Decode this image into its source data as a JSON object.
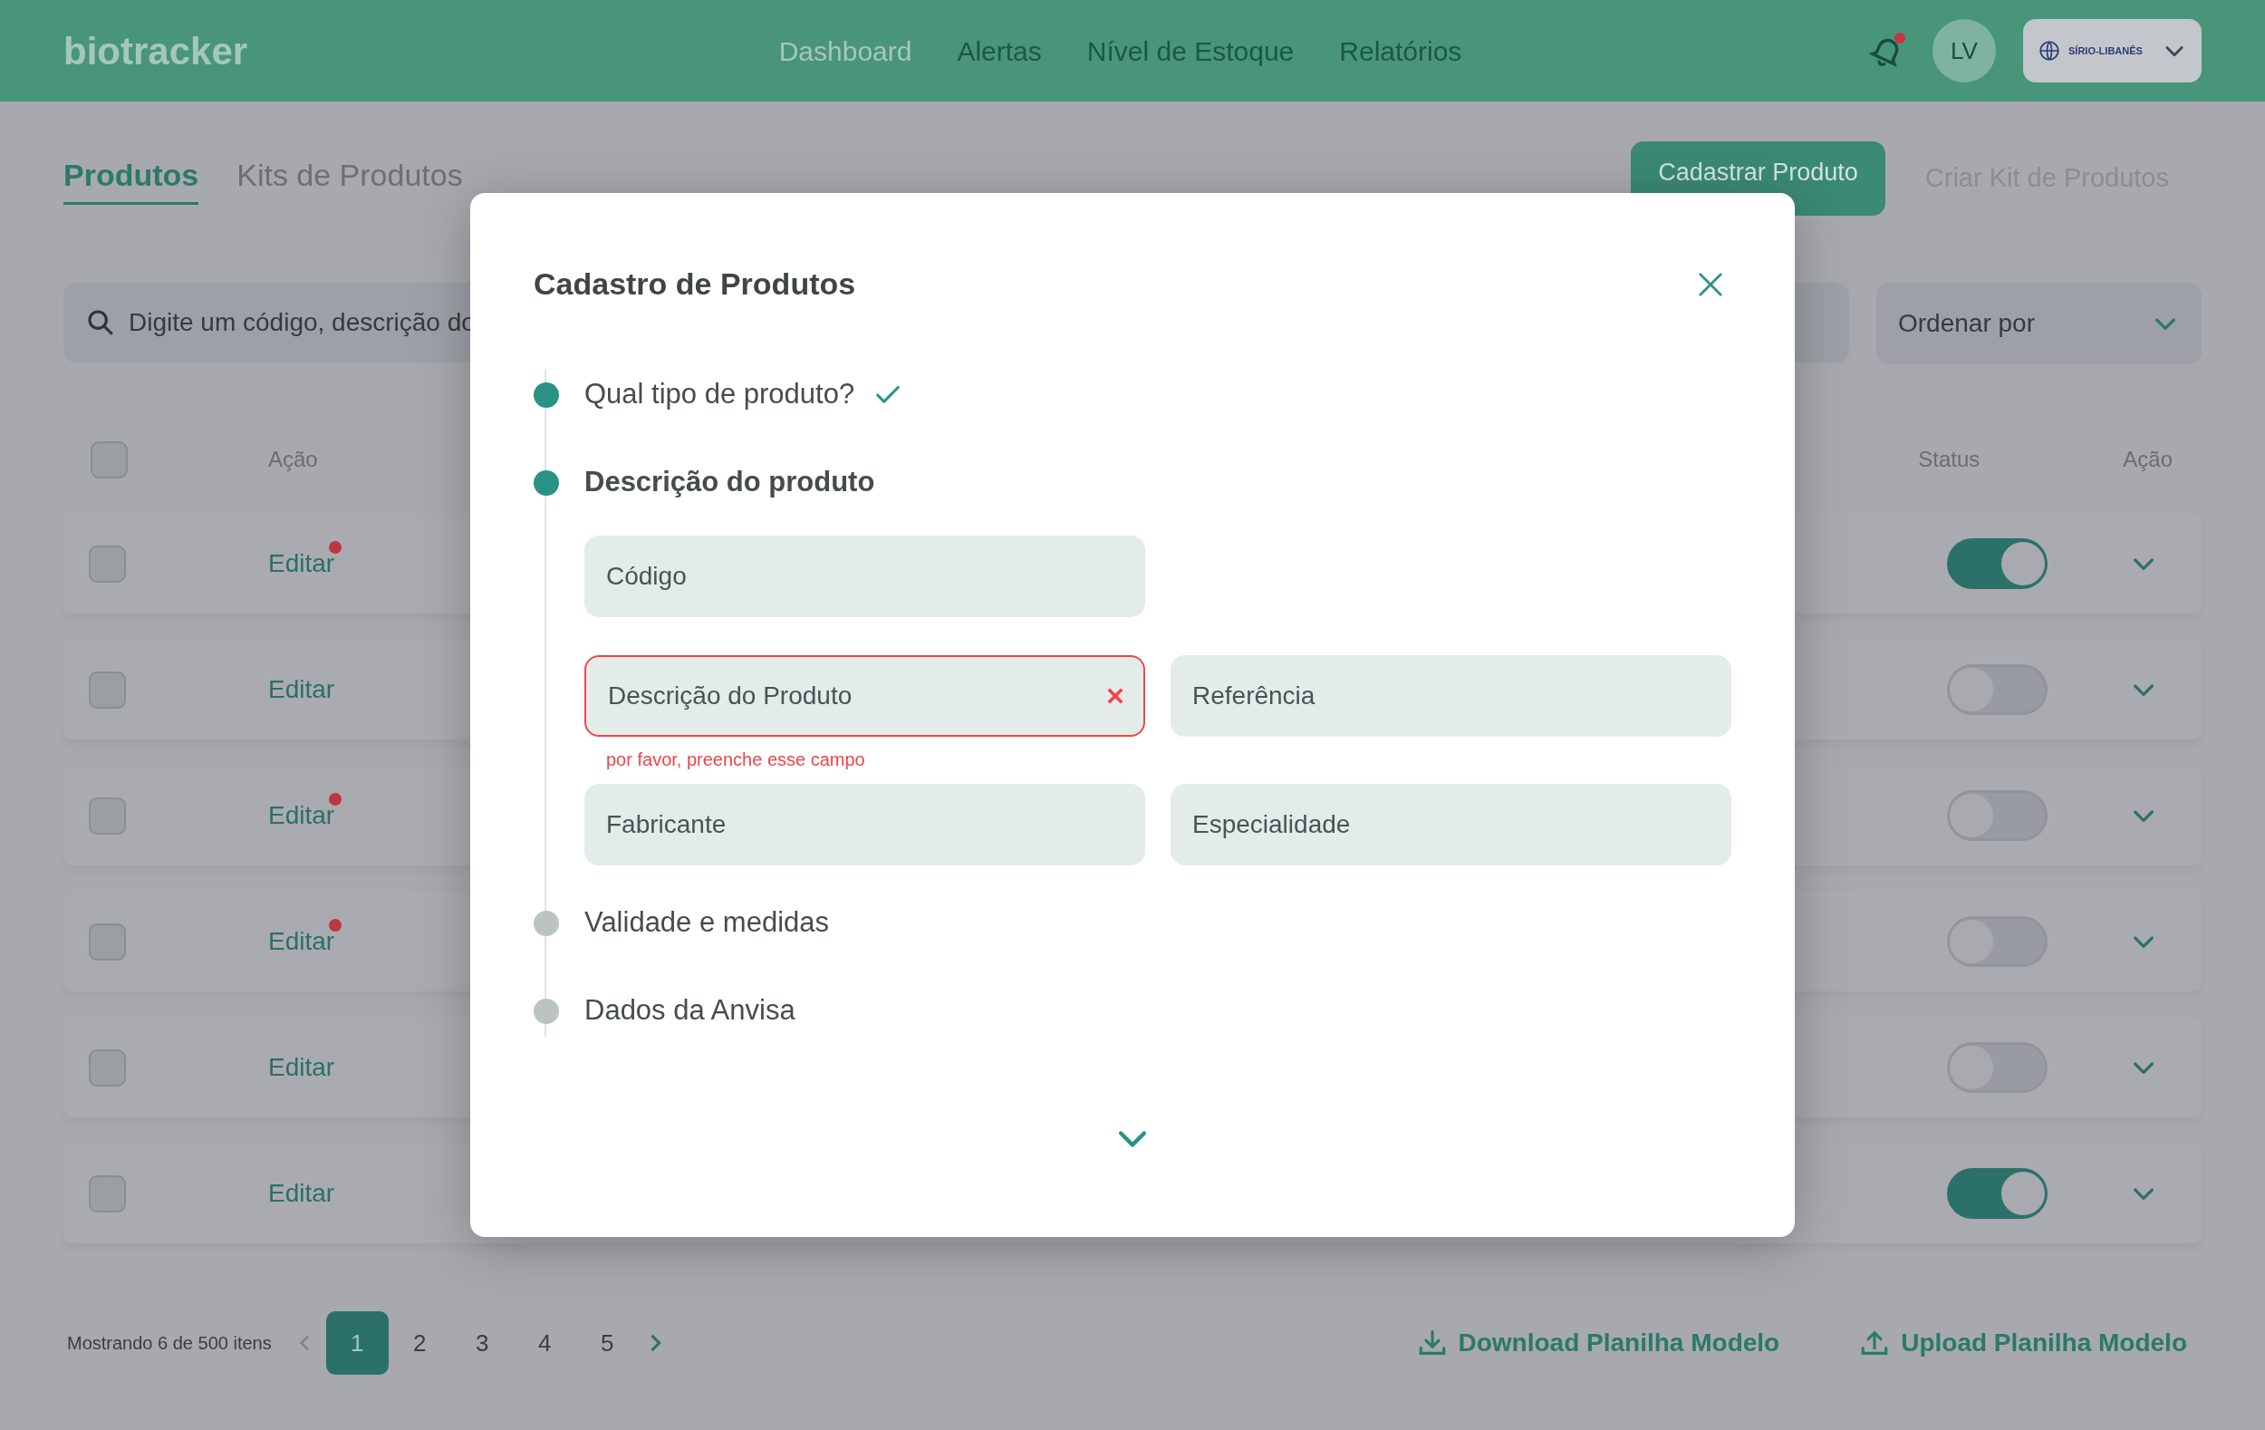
{
  "header": {
    "logo": "biotracker",
    "nav": [
      {
        "label": "Dashboard",
        "selected": true
      },
      {
        "label": "Alertas",
        "selected": false
      },
      {
        "label": "Nível de Estoque",
        "selected": false
      },
      {
        "label": "Relatórios",
        "selected": false
      }
    ],
    "notification": true,
    "avatar": "LV",
    "brand": "SÍRIO-LIBANÊS"
  },
  "tabs": [
    {
      "label": "Produtos",
      "selected": true
    },
    {
      "label": "Kits de Produtos",
      "selected": false
    }
  ],
  "primary_button": "Cadastrar Produto",
  "secondary_button": "Criar Kit de Produtos",
  "search": {
    "placeholder": "Digite um código, descrição do"
  },
  "sort": {
    "label": "Ordenar por"
  },
  "table": {
    "all_checked": false,
    "columns_left": [
      "Ação"
    ],
    "columns_right": [
      "Status",
      "Ação"
    ],
    "rows": [
      {
        "action": "Editar",
        "flagged": true,
        "checked": false,
        "on": true
      },
      {
        "action": "Editar",
        "flagged": false,
        "checked": false,
        "on": false
      },
      {
        "action": "Editar",
        "flagged": true,
        "checked": false,
        "on": false
      },
      {
        "action": "Editar",
        "flagged": true,
        "checked": false,
        "on": false
      },
      {
        "action": "Editar",
        "flagged": false,
        "checked": false,
        "on": false
      },
      {
        "action": "Editar",
        "flagged": false,
        "checked": false,
        "on": true
      }
    ]
  },
  "footer": {
    "summary": "Mostrando 6 de 500 itens",
    "pages": [
      {
        "label": "1",
        "selected": true
      },
      {
        "label": "2",
        "selected": false
      },
      {
        "label": "3",
        "selected": false
      },
      {
        "label": "4",
        "selected": false
      },
      {
        "label": "5",
        "selected": false
      }
    ],
    "download": "Download Planilha Modelo",
    "upload": "Upload Planilha Modelo"
  },
  "modal": {
    "title": "Cadastro de Produtos",
    "steps": [
      {
        "label": "Qual tipo de produto?",
        "done": true,
        "current": false
      },
      {
        "label": "Descrição do produto",
        "done": false,
        "current": true,
        "field_rows": [
          [
            {
              "placeholder": "Código"
            }
          ],
          [
            {
              "placeholder": "Descrição do Produto",
              "error": "por favor, preenche esse campo"
            },
            {
              "placeholder": "Referência"
            }
          ],
          [
            {
              "placeholder": "Fabricante"
            },
            {
              "placeholder": "Especialidade"
            }
          ]
        ]
      },
      {
        "label": "Validade e medidas",
        "done": false,
        "current": false
      },
      {
        "label": "Dados da Anvisa",
        "done": false,
        "current": false
      }
    ]
  }
}
